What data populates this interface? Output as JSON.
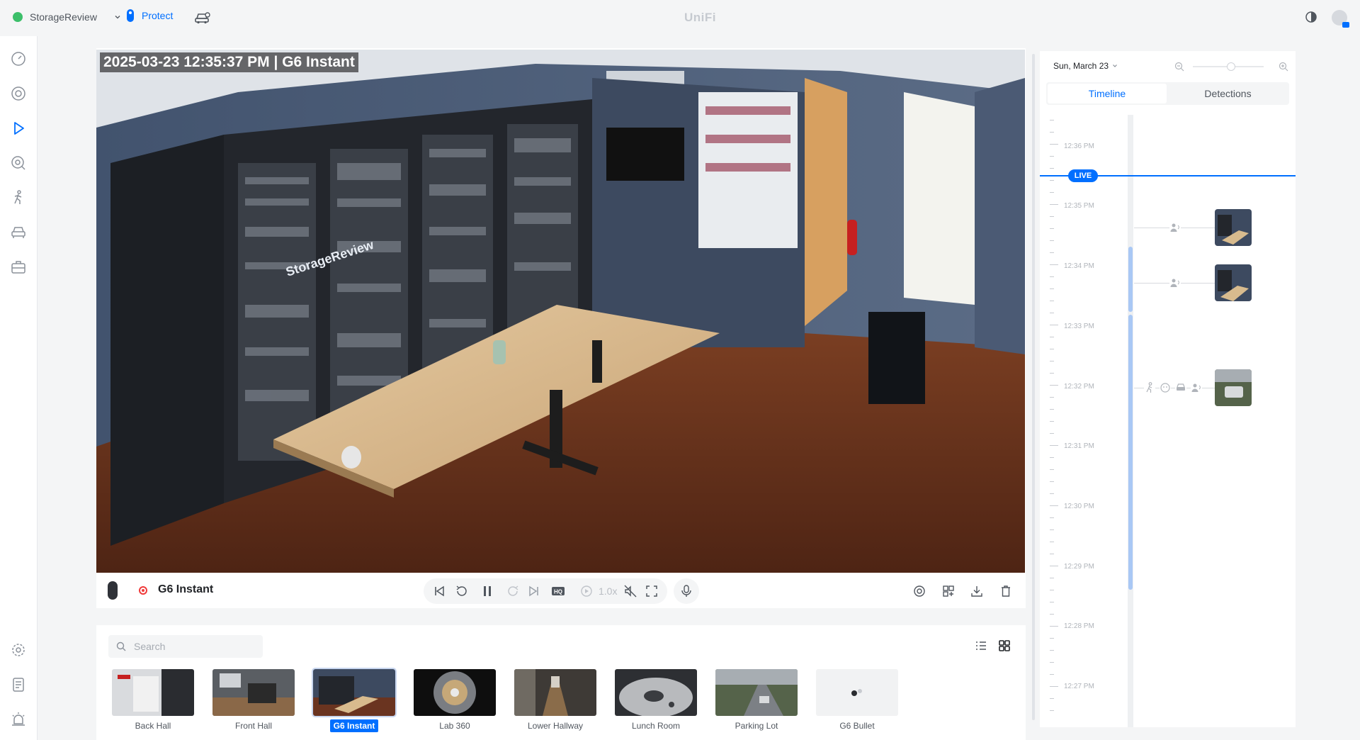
{
  "topbar": {
    "site_name": "StorageReview",
    "app_tab": "Protect",
    "brand": "UniFi"
  },
  "video": {
    "osd_text": "2025-03-23  12:35:37 PM  |  G6 Instant",
    "camera_name": "G6 Instant",
    "speed": "1.0x",
    "brand_on_rack": "StorageReview"
  },
  "cameras": {
    "search_placeholder": "Search",
    "items": [
      {
        "label": "Back Hall",
        "selected": false
      },
      {
        "label": "Front Hall",
        "selected": false
      },
      {
        "label": "G6 Instant",
        "selected": true
      },
      {
        "label": "Lab 360",
        "selected": false
      },
      {
        "label": "Lower Hallway",
        "selected": false
      },
      {
        "label": "Lunch Room",
        "selected": false
      },
      {
        "label": "Parking Lot",
        "selected": false
      },
      {
        "label": "G6 Bullet",
        "selected": false
      }
    ]
  },
  "timeline": {
    "date": "Sun, March 23",
    "tab_timeline": "Timeline",
    "tab_detections": "Detections",
    "live_label": "LIVE",
    "times": [
      "12:36 PM",
      "12:35 PM",
      "12:34 PM",
      "12:33 PM",
      "12:32 PM",
      "12:31 PM",
      "12:30 PM",
      "12:29 PM",
      "12:28 PM",
      "12:27 PM"
    ]
  },
  "colors": {
    "accent": "#006fff",
    "record": "#f03a3a"
  }
}
